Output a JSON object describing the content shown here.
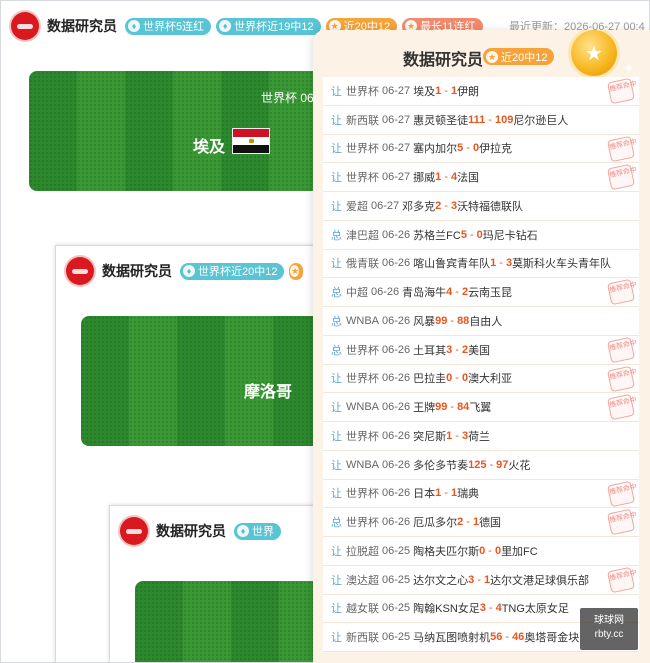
{
  "header": {
    "name": "数据研究员",
    "badges": [
      "世界杯5连红",
      "世界杯近19中12",
      "近20中12",
      "最长11连红"
    ],
    "updated": "最近更新：2026-06-27 00:4"
  },
  "main_card": {
    "title_partial": "世界杯 06",
    "team_left": "埃及"
  },
  "window2": {
    "name": "数据研究员",
    "badges": [
      "世界杯近20中12"
    ],
    "team_partial": "摩洛哥"
  },
  "window3": {
    "name": "数据研究员",
    "badges": [
      "世界"
    ]
  },
  "panel": {
    "title": "数据研究员",
    "badge": "近20中12",
    "rows": [
      {
        "type": "让",
        "league": "世界杯",
        "date": "06-27",
        "home": "埃及",
        "hs": "1",
        "as": "1",
        "away": "伊朗",
        "stamp": "推荐命中"
      },
      {
        "type": "让",
        "league": "新西联",
        "date": "06-27",
        "home": "惠灵顿圣徒",
        "hs": "111",
        "as": "109",
        "away": "尼尔逊巨人",
        "stamp": ""
      },
      {
        "type": "让",
        "league": "世界杯",
        "date": "06-27",
        "home": "塞内加尔",
        "hs": "5",
        "as": "0",
        "away": "伊拉克",
        "stamp": "推荐命中"
      },
      {
        "type": "让",
        "league": "世界杯",
        "date": "06-27",
        "home": "挪威",
        "hs": "1",
        "as": "4",
        "away": "法国",
        "stamp": "推荐命中"
      },
      {
        "type": "让",
        "league": "爱超",
        "date": "06-27",
        "home": "邓多克",
        "hs": "2",
        "as": "3",
        "away": "沃特福德联队",
        "stamp": ""
      },
      {
        "type": "总",
        "league": "津巴超",
        "date": "06-26",
        "home": "苏格兰FC",
        "hs": "5",
        "as": "0",
        "away": "玛尼卡钻石",
        "stamp": ""
      },
      {
        "type": "让",
        "league": "俄青联",
        "date": "06-26",
        "home": "喀山鲁宾青年队",
        "hs": "1",
        "as": "3",
        "away": "莫斯科火车头青年队",
        "stamp": ""
      },
      {
        "type": "总",
        "league": "中超",
        "date": "06-26",
        "home": "青岛海牛",
        "hs": "4",
        "as": "2",
        "away": "云南玉昆",
        "stamp": "推荐命中"
      },
      {
        "type": "总",
        "league": "WNBA",
        "date": "06-26",
        "home": "风暴",
        "hs": "99",
        "as": "88",
        "away": "自由人",
        "stamp": ""
      },
      {
        "type": "总",
        "league": "世界杯",
        "date": "06-26",
        "home": "土耳其",
        "hs": "3",
        "as": "2",
        "away": "美国",
        "stamp": "推荐命中"
      },
      {
        "type": "让",
        "league": "世界杯",
        "date": "06-26",
        "home": "巴拉圭",
        "hs": "0",
        "as": "0",
        "away": "澳大利亚",
        "stamp": "推荐命中"
      },
      {
        "type": "让",
        "league": "WNBA",
        "date": "06-26",
        "home": "王牌",
        "hs": "99",
        "as": "84",
        "away": "飞翼",
        "stamp": "推荐命中"
      },
      {
        "type": "让",
        "league": "世界杯",
        "date": "06-26",
        "home": "突尼斯",
        "hs": "1",
        "as": "3",
        "away": "荷兰",
        "stamp": ""
      },
      {
        "type": "让",
        "league": "WNBA",
        "date": "06-26",
        "home": "多伦多节奏",
        "hs": "125",
        "as": "97",
        "away": "火花",
        "stamp": ""
      },
      {
        "type": "让",
        "league": "世界杯",
        "date": "06-26",
        "home": "日本",
        "hs": "1",
        "as": "1",
        "away": "瑞典",
        "stamp": "推荐命中"
      },
      {
        "type": "总",
        "league": "世界杯",
        "date": "06-26",
        "home": "厄瓜多尔",
        "hs": "2",
        "as": "1",
        "away": "德国",
        "stamp": "推荐命中"
      },
      {
        "type": "让",
        "league": "拉脱超",
        "date": "06-25",
        "home": "陶格夫匹尔斯",
        "hs": "0",
        "as": "0",
        "away": "里加FC",
        "stamp": ""
      },
      {
        "type": "让",
        "league": "澳达超",
        "date": "06-25",
        "home": "达尔文之心",
        "hs": "3",
        "as": "1",
        "away": "达尔文港足球俱乐部",
        "stamp": "推荐命中"
      },
      {
        "type": "让",
        "league": "越女联",
        "date": "06-25",
        "home": "陶翰KSN女足",
        "hs": "3",
        "as": "4",
        "away": "TNG太原女足",
        "stamp": ""
      },
      {
        "type": "让",
        "league": "新西联",
        "date": "06-25",
        "home": "马纳瓦图喷射机",
        "hs": "56",
        "as": "46",
        "away": "奥塔哥金块",
        "stamp": ""
      }
    ]
  },
  "watermark": {
    "line1": "球球网",
    "line2": "rbty.cc"
  }
}
